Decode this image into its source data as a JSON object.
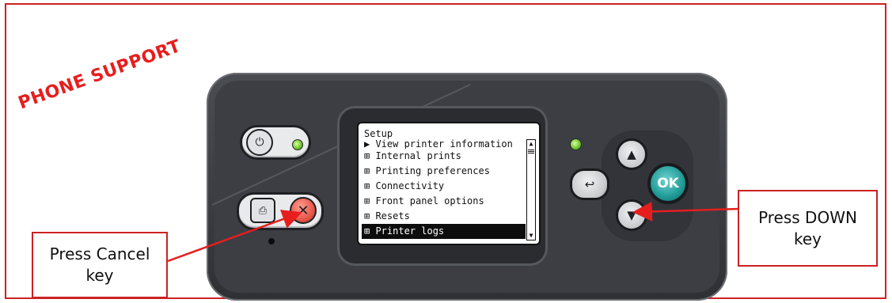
{
  "stamp": {
    "text": "PHONE SUPPORT",
    "color": "#e61e1e"
  },
  "front_panel": {
    "screen": {
      "title": "Setup",
      "items": [
        {
          "label": "▶ View printer information",
          "state": "partially-scrolled"
        },
        {
          "label": "⊞ Internal prints"
        },
        {
          "label": "⊞ Printing preferences"
        },
        {
          "label": "⊞ Connectivity"
        },
        {
          "label": "⊞ Front panel options"
        },
        {
          "label": "⊞ Resets"
        },
        {
          "label": "⊞ Printer logs",
          "selected": true
        }
      ]
    },
    "keys": {
      "power": {
        "icon": "power-icon",
        "led": "green"
      },
      "menu": {
        "icon": "menu-icon"
      },
      "cancel": {
        "icon": "cancel-x-icon",
        "color": "#e8574a"
      },
      "back": {
        "icon": "back-arrow-icon"
      },
      "up": {
        "icon": "up-arrow-icon"
      },
      "down": {
        "icon": "down-arrow-icon"
      },
      "ok": {
        "label": "OK",
        "color": "#1f9a96"
      },
      "status_led": "green"
    }
  },
  "callouts": {
    "cancel": {
      "line1": "Press Cancel",
      "line2": "key"
    },
    "down": {
      "line1": "Press DOWN",
      "line2": "key"
    }
  },
  "colors": {
    "frame": "#cc2222",
    "arrow": "#e61e1e",
    "panel": "#3c3e43"
  }
}
